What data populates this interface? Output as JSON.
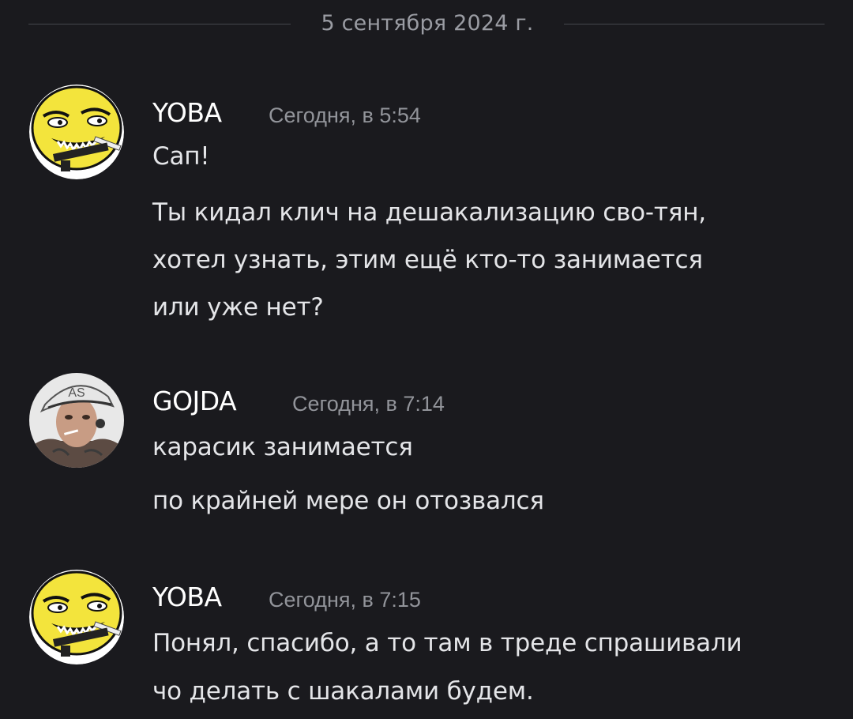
{
  "date_divider": "5 сентября 2024 г.",
  "messages": [
    {
      "author": "YOBA",
      "timestamp": "Сегодня, в 5:54",
      "avatar_icon": "yoba-face-icon",
      "lines": [
        "Сап!",
        "Ты кидал клич на дешакализацию сво-тян,",
        "хотел узнать, этим ещё кто-то занимается",
        "или уже нет?"
      ]
    },
    {
      "author": "GOJDA",
      "timestamp": "Сегодня, в 7:14",
      "avatar_icon": "user-photo-avatar",
      "lines": [
        "карасик занимается",
        "по крайней мере он отозвался"
      ]
    },
    {
      "author": "YOBA",
      "timestamp": "Сегодня, в 7:15",
      "avatar_icon": "yoba-face-icon",
      "lines": [
        "Понял, спасибо, а то там в треде спрашивали",
        "чо делать с шакалами будем."
      ]
    }
  ],
  "colors": {
    "background": "#1a1a1e",
    "author": "#ffffff",
    "timestamp": "#92949a",
    "message_text": "#e4e5e8",
    "divider": "#45474d",
    "yoba_yellow": "#f3e43c"
  }
}
